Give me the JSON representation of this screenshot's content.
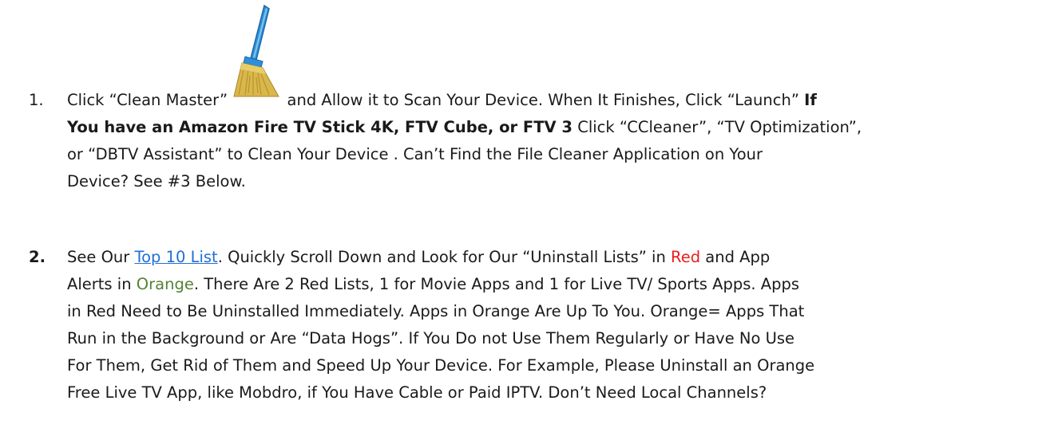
{
  "item1": {
    "number": "1.",
    "l1_a": "Click “Clean Master”",
    "icon": "clean-master-broom-icon",
    "l1_b": "and Allow it to Scan Your Device. When It Finishes, Click “Launch”",
    "l1_bold": "If",
    "l2_bold": "You have an Amazon Fire TV Stick 4K, FTV Cube, or FTV 3",
    "l2_rest": "Click  “CCleaner”, “TV Optimization”,",
    "l3": "or “DBTV Assistant” to Clean Your Device . Can’t Find the File Cleaner Application on Your",
    "l4": "Device? See #3 Below."
  },
  "item2": {
    "number": "2.",
    "l1_a": "See Our",
    "link": "Top 10 List",
    "l1_b": ". Quickly Scroll Down and Look for Our “Uninstall Lists” in",
    "l1_red": "Red",
    "l1_c": "and App",
    "l2_a": "Alerts in",
    "l2_orange": "Orange",
    "l2_b": ". There Are 2 Red Lists, 1 for Movie Apps and 1 for Live TV/ Sports Apps. Apps",
    "l3": "in Red Need to Be Uninstalled Immediately. Apps in Orange Are Up To You. Orange=  Apps That",
    "l4": "Run in the Background or Are “Data Hogs”. If You Do not Use Them Regularly or Have No Use",
    "l5": "For Them, Get Rid of Them and Speed Up Your Device. For Example, Please Uninstall an Orange",
    "l6": "Free Live TV App, like Mobdro, if You Have Cable or Paid IPTV. Don’t Need Local Channels?"
  },
  "colors": {
    "red": "#ee1c1c",
    "orange_text": "#548235",
    "link": "#1f6fd6"
  }
}
